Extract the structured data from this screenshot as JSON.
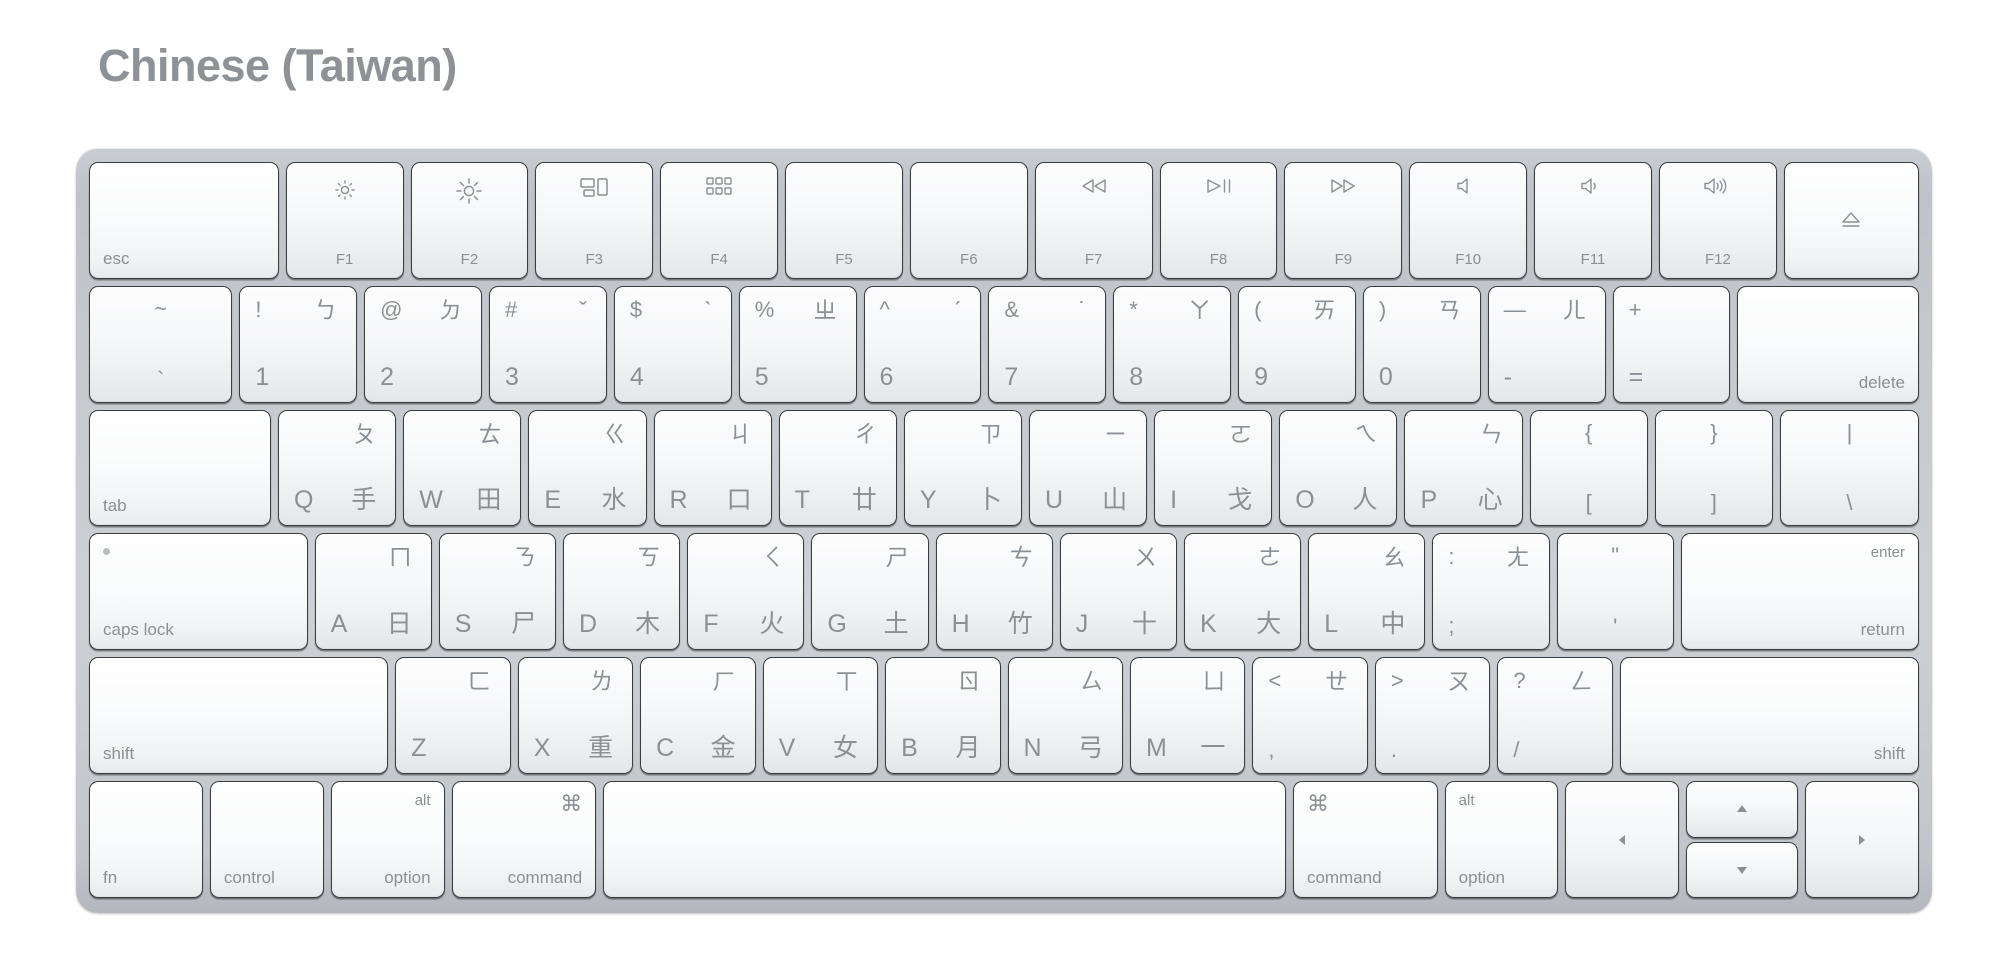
{
  "page_title": "Chinese (Taiwan)",
  "colors": {
    "title": "#8e9296",
    "key_label": "#8b9095",
    "chassis_light": "#cdd1d5",
    "chassis_dark": "#b4b8be",
    "key_face": "#f7f8f9",
    "key_border": "#3a3d42"
  },
  "rows": {
    "function_row": [
      {
        "name": "esc",
        "label": "esc",
        "icon": null,
        "width": 1.62
      },
      {
        "name": "f1",
        "label": "F1",
        "icon": "brightness-down-icon",
        "width": 1.0
      },
      {
        "name": "f2",
        "label": "F2",
        "icon": "brightness-up-icon",
        "width": 1.0
      },
      {
        "name": "f3",
        "label": "F3",
        "icon": "mission-control-icon",
        "width": 1.0
      },
      {
        "name": "f4",
        "label": "F4",
        "icon": "launchpad-icon",
        "width": 1.0
      },
      {
        "name": "f5",
        "label": "F5",
        "icon": null,
        "width": 1.0
      },
      {
        "name": "f6",
        "label": "F6",
        "icon": null,
        "width": 1.0
      },
      {
        "name": "f7",
        "label": "F7",
        "icon": "rewind-icon",
        "width": 1.0
      },
      {
        "name": "f8",
        "label": "F8",
        "icon": "play-pause-icon",
        "width": 1.0
      },
      {
        "name": "f9",
        "label": "F9",
        "icon": "fast-forward-icon",
        "width": 1.0
      },
      {
        "name": "f10",
        "label": "F10",
        "icon": "mute-icon",
        "width": 1.0
      },
      {
        "name": "f11",
        "label": "F11",
        "icon": "volume-down-icon",
        "width": 1.0
      },
      {
        "name": "f12",
        "label": "F12",
        "icon": "volume-up-icon",
        "width": 1.0
      },
      {
        "name": "eject",
        "label": "",
        "icon": "eject-icon",
        "width": 1.15
      }
    ],
    "number_row": [
      {
        "name": "backquote",
        "top_left": "~",
        "top_right": "",
        "bottom_left": "`",
        "centered": true,
        "width": 1.22
      },
      {
        "name": "digit-1",
        "top_left": "!",
        "top_right": "ㄅ",
        "bottom_left": "1",
        "centered": false,
        "width": 1.0
      },
      {
        "name": "digit-2",
        "top_left": "@",
        "top_right": "ㄉ",
        "bottom_left": "2",
        "centered": false,
        "width": 1.0
      },
      {
        "name": "digit-3",
        "top_left": "#",
        "top_right": "ˇ",
        "bottom_left": "3",
        "centered": false,
        "width": 1.0
      },
      {
        "name": "digit-4",
        "top_left": "$",
        "top_right": "ˋ",
        "bottom_left": "4",
        "centered": false,
        "width": 1.0
      },
      {
        "name": "digit-5",
        "top_left": "%",
        "top_right": "ㄓ",
        "bottom_left": "5",
        "centered": false,
        "width": 1.0
      },
      {
        "name": "digit-6",
        "top_left": "^",
        "top_right": "ˊ",
        "bottom_left": "6",
        "centered": false,
        "width": 1.0
      },
      {
        "name": "digit-7",
        "top_left": "&",
        "top_right": "˙",
        "bottom_left": "7",
        "centered": false,
        "width": 1.0
      },
      {
        "name": "digit-8",
        "top_left": "*",
        "top_right": "ㄚ",
        "bottom_left": "8",
        "centered": false,
        "width": 1.0
      },
      {
        "name": "digit-9",
        "top_left": "(",
        "top_right": "ㄞ",
        "bottom_left": "9",
        "centered": false,
        "width": 1.0
      },
      {
        "name": "digit-0",
        "top_left": ")",
        "top_right": "ㄢ",
        "bottom_left": "0",
        "centered": false,
        "width": 1.0
      },
      {
        "name": "minus",
        "top_left": "—",
        "top_right": "ㄦ",
        "bottom_left": "-",
        "centered": false,
        "width": 1.0
      },
      {
        "name": "equal",
        "top_left": "+",
        "top_right": "",
        "bottom_left": "=",
        "centered": false,
        "width": 1.0
      },
      {
        "name": "delete",
        "label": "delete",
        "align": "right",
        "width": 1.55
      }
    ],
    "tab_row": [
      {
        "name": "tab",
        "label": "tab",
        "align": "left",
        "width": 1.55
      },
      {
        "name": "key-q",
        "alpha": "Q",
        "bopomofo": "ㄆ",
        "cangjie": "手",
        "width": 1.0
      },
      {
        "name": "key-w",
        "alpha": "W",
        "bopomofo": "ㄊ",
        "cangjie": "田",
        "width": 1.0
      },
      {
        "name": "key-e",
        "alpha": "E",
        "bopomofo": "ㄍ",
        "cangjie": "水",
        "width": 1.0
      },
      {
        "name": "key-r",
        "alpha": "R",
        "bopomofo": "ㄐ",
        "cangjie": "口",
        "width": 1.0
      },
      {
        "name": "key-t",
        "alpha": "T",
        "bopomofo": "ㄔ",
        "cangjie": "廿",
        "width": 1.0
      },
      {
        "name": "key-y",
        "alpha": "Y",
        "bopomofo": "ㄗ",
        "cangjie": "卜",
        "width": 1.0
      },
      {
        "name": "key-u",
        "alpha": "U",
        "bopomofo": "ㄧ",
        "cangjie": "山",
        "width": 1.0
      },
      {
        "name": "key-i",
        "alpha": "I",
        "bopomofo": "ㄛ",
        "cangjie": "戈",
        "width": 1.0
      },
      {
        "name": "key-o",
        "alpha": "O",
        "bopomofo": "ㄟ",
        "cangjie": "人",
        "width": 1.0
      },
      {
        "name": "key-p",
        "alpha": "P",
        "bopomofo": "ㄣ",
        "cangjie": "心",
        "width": 1.0
      },
      {
        "name": "bracket-left",
        "top_left": "{",
        "bottom_left": "[",
        "width": 1.0
      },
      {
        "name": "bracket-right",
        "top_left": "}",
        "bottom_left": "]",
        "width": 1.0
      },
      {
        "name": "backslash",
        "top_left": "|",
        "bottom_left": "\\",
        "width": 1.18
      }
    ],
    "caps_row": [
      {
        "name": "caps-lock",
        "label": "caps lock",
        "align": "left",
        "indicator": true,
        "width": 1.88
      },
      {
        "name": "key-a",
        "alpha": "A",
        "bopomofo": "ㄇ",
        "cangjie": "日",
        "width": 1.0
      },
      {
        "name": "key-s",
        "alpha": "S",
        "bopomofo": "ㄋ",
        "cangjie": "尸",
        "width": 1.0
      },
      {
        "name": "key-d",
        "alpha": "D",
        "bopomofo": "ㄎ",
        "cangjie": "木",
        "width": 1.0
      },
      {
        "name": "key-f",
        "alpha": "F",
        "bopomofo": "ㄑ",
        "cangjie": "火",
        "width": 1.0
      },
      {
        "name": "key-g",
        "alpha": "G",
        "bopomofo": "ㄕ",
        "cangjie": "土",
        "width": 1.0
      },
      {
        "name": "key-h",
        "alpha": "H",
        "bopomofo": "ㄘ",
        "cangjie": "竹",
        "width": 1.0
      },
      {
        "name": "key-j",
        "alpha": "J",
        "bopomofo": "ㄨ",
        "cangjie": "十",
        "width": 1.0
      },
      {
        "name": "key-k",
        "alpha": "K",
        "bopomofo": "ㄜ",
        "cangjie": "大",
        "width": 1.0
      },
      {
        "name": "key-l",
        "alpha": "L",
        "bopomofo": "ㄠ",
        "cangjie": "中",
        "width": 1.0
      },
      {
        "name": "semicolon",
        "top_left": ":",
        "top_right": "ㄤ",
        "bottom_left": ";",
        "width": 1.0
      },
      {
        "name": "quote",
        "top_left": "\"",
        "top_right": "",
        "bottom_left": "'",
        "width": 1.0
      },
      {
        "name": "return",
        "label_top": "enter",
        "label_bottom": "return",
        "align": "right",
        "width": 2.05
      }
    ],
    "shift_row": [
      {
        "name": "shift-left",
        "label": "shift",
        "align": "left",
        "width": 2.62
      },
      {
        "name": "key-z",
        "alpha": "Z",
        "bopomofo": "ㄈ",
        "cangjie": "",
        "width": 1.0
      },
      {
        "name": "key-x",
        "alpha": "X",
        "bopomofo": "ㄌ",
        "cangjie": "重",
        "width": 1.0
      },
      {
        "name": "key-c",
        "alpha": "C",
        "bopomofo": "ㄏ",
        "cangjie": "金",
        "width": 1.0
      },
      {
        "name": "key-v",
        "alpha": "V",
        "bopomofo": "ㄒ",
        "cangjie": "女",
        "width": 1.0
      },
      {
        "name": "key-b",
        "alpha": "B",
        "bopomofo": "ㄖ",
        "cangjie": "月",
        "width": 1.0
      },
      {
        "name": "key-n",
        "alpha": "N",
        "bopomofo": "ㄙ",
        "cangjie": "弓",
        "width": 1.0
      },
      {
        "name": "key-m",
        "alpha": "M",
        "bopomofo": "ㄩ",
        "cangjie": "一",
        "width": 1.0
      },
      {
        "name": "comma",
        "top_left": "<",
        "top_right": "ㄝ",
        "bottom_left": ",",
        "width": 1.0
      },
      {
        "name": "period",
        "top_left": ">",
        "top_right": "ㄡ",
        "bottom_left": ".",
        "width": 1.0
      },
      {
        "name": "slash",
        "top_left": "?",
        "top_right": "ㄥ",
        "bottom_left": "/",
        "width": 1.0
      },
      {
        "name": "shift-right",
        "label": "shift",
        "align": "right",
        "width": 2.62
      }
    ],
    "bottom_row": [
      {
        "name": "fn",
        "label": "fn",
        "align": "left",
        "width": 1.16
      },
      {
        "name": "control",
        "label": "control",
        "align": "left",
        "width": 1.16
      },
      {
        "name": "option-left",
        "label_top": "alt",
        "label_bottom": "option",
        "align": "right",
        "width": 1.16
      },
      {
        "name": "command-left",
        "label_top": "⌘",
        "label_bottom": "command",
        "align": "right",
        "width": 1.48
      },
      {
        "name": "space",
        "label": "",
        "width": 7.06
      },
      {
        "name": "command-right",
        "label_top": "⌘",
        "label_bottom": "command",
        "align": "left",
        "width": 1.48
      },
      {
        "name": "option-right",
        "label_top": "alt",
        "label_bottom": "option",
        "align": "left",
        "width": 1.16
      },
      {
        "name": "arrow-left",
        "icon": "arrow-left-icon",
        "width": 1.16
      },
      {
        "name": "arrow-updown",
        "icon_up": "arrow-up-icon",
        "icon_down": "arrow-down-icon",
        "width": 1.16
      },
      {
        "name": "arrow-right",
        "icon": "arrow-right-icon",
        "width": 1.16
      }
    ]
  }
}
